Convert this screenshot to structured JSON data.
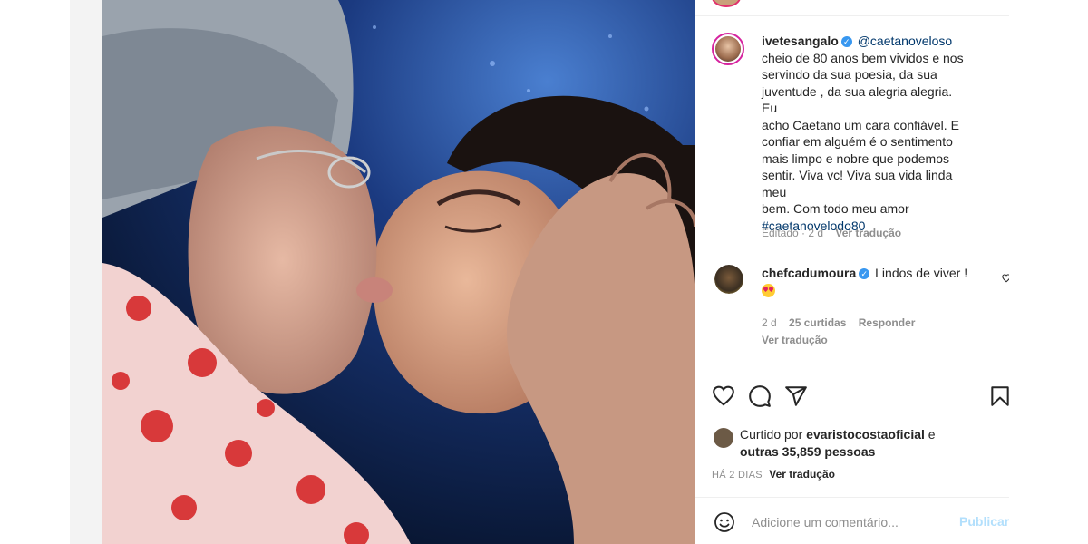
{
  "post": {
    "author": "ivetesangalo",
    "mention": "@caetanoveloso",
    "caption_lines": [
      "cheio de 80 anos bem vividos e nos",
      "servindo da sua poesia, da sua",
      "juventude , da sua alegria alegria. Eu",
      "acho Caetano um cara confiável. E",
      "confiar em alguém é o sentimento",
      "mais limpo e nobre que podemos",
      "sentir. Viva vc! Viva sua vida linda meu",
      "bem. Com todo meu amor"
    ],
    "hashtag": "#caetanovelodo80",
    "edited_label": "Editado",
    "edited_time": "2 d",
    "translate_label": "Ver tradução"
  },
  "comment": {
    "author": "chefcadumoura",
    "text": "Lindos de viver !",
    "time": "2 d",
    "likes": "25 curtidas",
    "reply_label": "Responder",
    "translate_label": "Ver tradução"
  },
  "likes": {
    "prefix": "Curtido por",
    "user": "evaristocostaoficial",
    "conjunction": "e",
    "others": "outras 35,859 pessoas"
  },
  "timestamp": {
    "text": "HÁ 2 DIAS",
    "translate_label": "Ver tradução"
  },
  "comment_box": {
    "placeholder": "Adicione um comentário...",
    "publish_label": "Publicar"
  },
  "icons": {
    "like": "heart-icon",
    "comment": "comment-icon",
    "share": "share-icon",
    "save": "bookmark-icon",
    "emoji": "emoji-icon"
  },
  "colors": {
    "link": "#00376b",
    "verified": "#3897f0",
    "muted": "#8e8e8e",
    "publish": "#b2dffc"
  }
}
